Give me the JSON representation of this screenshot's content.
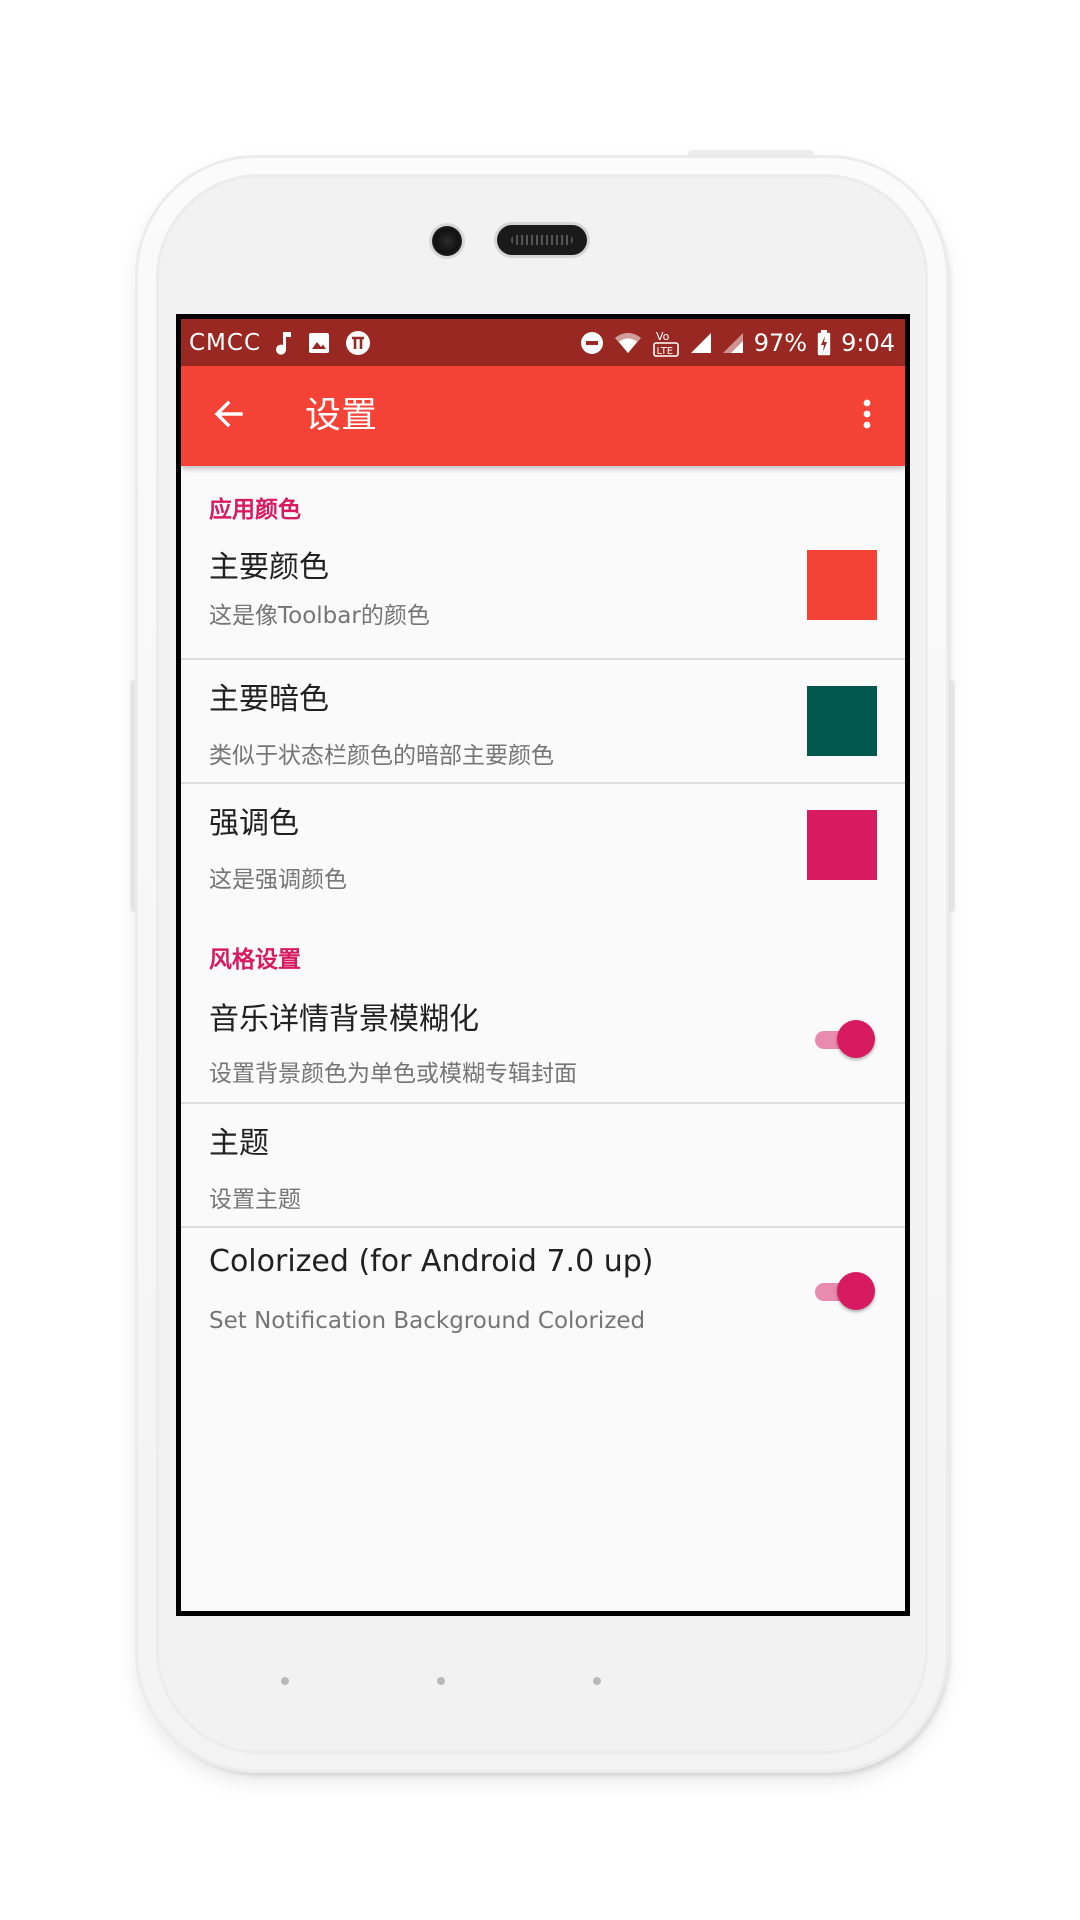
{
  "status_bar": {
    "carrier": "CMCC",
    "battery": "97%",
    "time": "9:04",
    "background": "#992722"
  },
  "toolbar": {
    "title": "设置",
    "background": "#f44336"
  },
  "sections": {
    "app_colors": {
      "header": "应用颜色",
      "items": [
        {
          "title": "主要颜色",
          "summary": "这是像Toolbar的颜色",
          "color": "#f44336"
        },
        {
          "title": "主要暗色",
          "summary": "类似于状态栏颜色的暗部主要颜色",
          "color": "#00574b"
        },
        {
          "title": "强调色",
          "summary": "这是强调颜色",
          "color": "#d81b60"
        }
      ]
    },
    "style": {
      "header": "风格设置",
      "items": [
        {
          "title": "音乐详情背景模糊化",
          "summary": "设置背景颜色为单色或模糊专辑封面",
          "switch_on": true
        },
        {
          "title": "主题",
          "summary": "设置主题"
        },
        {
          "title": "Colorized (for Android 7.0 up)",
          "summary": "Set Notification Background Colorized",
          "switch_on": true
        }
      ]
    }
  },
  "colors": {
    "accent": "#d81b60",
    "primary": "#f44336",
    "primary_dark": "#992722"
  },
  "icons": {
    "status_left": [
      "music-note-icon",
      "image-icon",
      "app-notification-icon"
    ],
    "status_right": [
      "do-not-disturb-icon",
      "wifi-icon",
      "volte-icon",
      "signal-icon",
      "signal-icon",
      "battery-charging-icon"
    ],
    "toolbar": [
      "back-arrow-icon",
      "more-vert-icon"
    ]
  }
}
